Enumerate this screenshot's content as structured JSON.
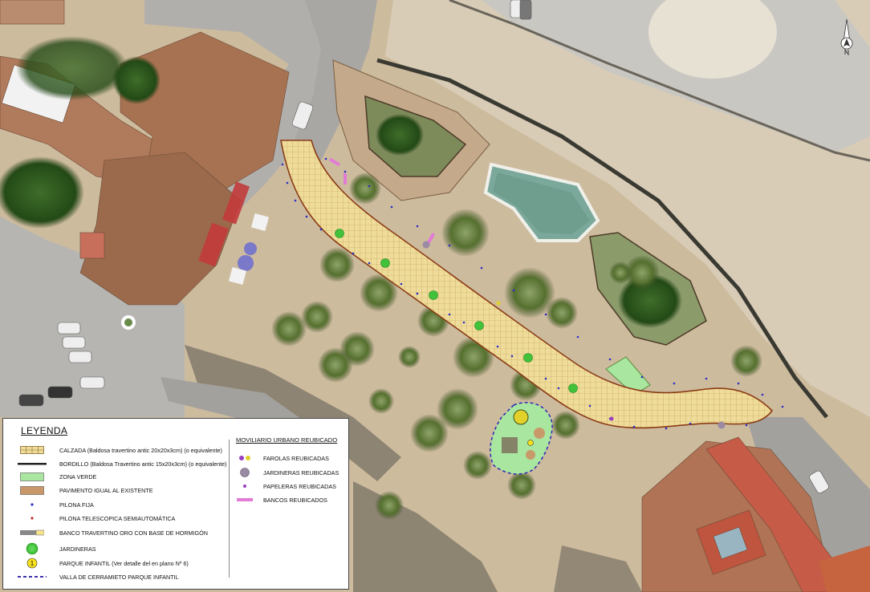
{
  "legend": {
    "title": "LEYENDA",
    "items": [
      {
        "label": "CALZADA  (Baldosa travertino antic 20x20x3cm)  (o equivalente)",
        "icon": "paving-grid-icon"
      },
      {
        "label": "BORDILLO (Baldosa Travertino antic 15x20x3cm) (o equivalente)",
        "icon": "curb-line-icon"
      },
      {
        "label": "ZONA VERDE",
        "icon": "green-zone-icon"
      },
      {
        "label": "PAVIMENTO IGUAL AL EXISTENTE",
        "icon": "existing-pavement-icon"
      },
      {
        "label": "PILONA FIJA",
        "icon": "fixed-bollard-icon"
      },
      {
        "label": "PILONA TELESCOPICA SEMIAUTOMÁTICA",
        "icon": "telescopic-bollard-icon"
      },
      {
        "label": "BANCO TRAVERTINO ORO CON BASE DE HORMIGÓN",
        "icon": "bench-icon"
      },
      {
        "label": "JARDINERAS",
        "icon": "planter-icon"
      },
      {
        "label": "PARQUE INFANTIL (Ver detalle del en plano Nº 6)",
        "icon": "playground-icon"
      },
      {
        "label": "VALLA DE CERRAMIETO PARQUE INFANTIL",
        "icon": "fence-dashed-icon"
      }
    ],
    "furniture_title": "MOVILIARIO URBANO REUBICADO",
    "furniture_items": [
      {
        "label": "FAROLAS REUBICADAS",
        "icon": "streetlight-icon"
      },
      {
        "label": "JARDINERAS REUBICADAS",
        "icon": "relocated-planter-icon"
      },
      {
        "label": "PAPELERAS REUBICADAS",
        "icon": "bin-icon"
      },
      {
        "label": "BANCOS REUBICADOS",
        "icon": "relocated-bench-icon"
      }
    ],
    "playground_symbol": "1"
  },
  "colors": {
    "paving": "#f0dc9a",
    "paving_grid": "#b89a4e",
    "curb": "#8a3c16",
    "green_zone": "#a9e6a0",
    "existing_pavement": "#c9986a",
    "fixed_bollard": "#2b2fc4",
    "telescopic_bollard": "#c42b2b",
    "fence": "#3a2fb0",
    "bench_pink": "#e27ad6",
    "planter": "#41c23a"
  },
  "north_arrow": "north-arrow-icon"
}
